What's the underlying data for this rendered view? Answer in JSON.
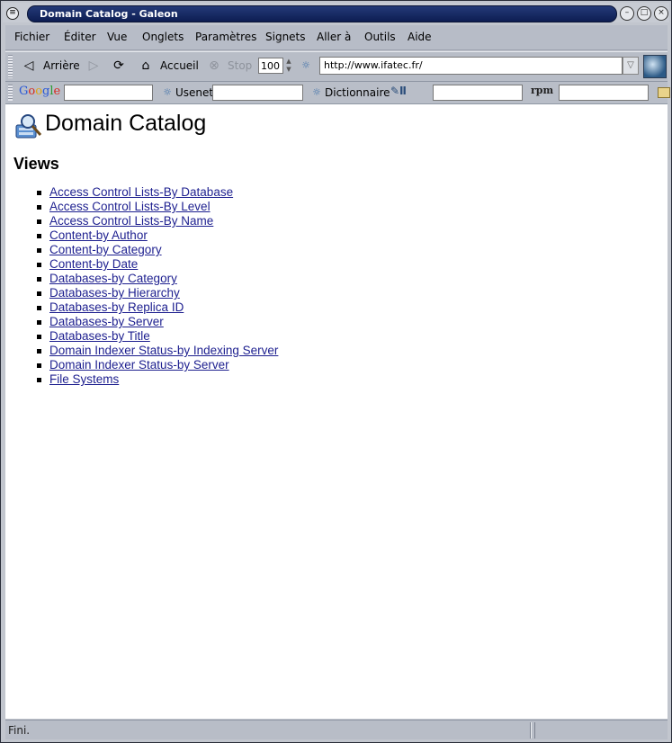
{
  "window": {
    "title": "Domain Catalog - Galeon"
  },
  "menubar": {
    "items": [
      "Fichier",
      "Éditer",
      "Vue",
      "Onglets",
      "Paramètres",
      "Signets",
      "Aller à",
      "Outils",
      "Aide"
    ]
  },
  "toolbar": {
    "back_label": "Arrière",
    "home_label": "Accueil",
    "stop_label": "Stop",
    "zoom_value": "100",
    "url_value": "http://www.ifatec.fr/"
  },
  "searchbar": {
    "usenet_label": "Usenet",
    "dictionary_label": "Dictionnaire",
    "rpm_label": "rpm"
  },
  "page": {
    "title": "Domain Catalog",
    "section_heading": "Views",
    "links": [
      "Access Control Lists-By Database",
      "Access Control Lists-By Level",
      "Access Control Lists-By Name",
      "Content-by Author",
      "Content-by Category",
      "Content-by Date",
      "Databases-by Category",
      "Databases-by Hierarchy",
      "Databases-by Replica ID",
      "Databases-by Server",
      "Databases-by Title",
      "Domain Indexer Status-by Indexing Server",
      "Domain Indexer Status-by Server",
      "File Systems"
    ]
  },
  "status": {
    "text": "Fini."
  },
  "colors": {
    "title_bar": "#1a2c66",
    "link": "#1d1f8f",
    "chrome": "#b8bdc7"
  }
}
